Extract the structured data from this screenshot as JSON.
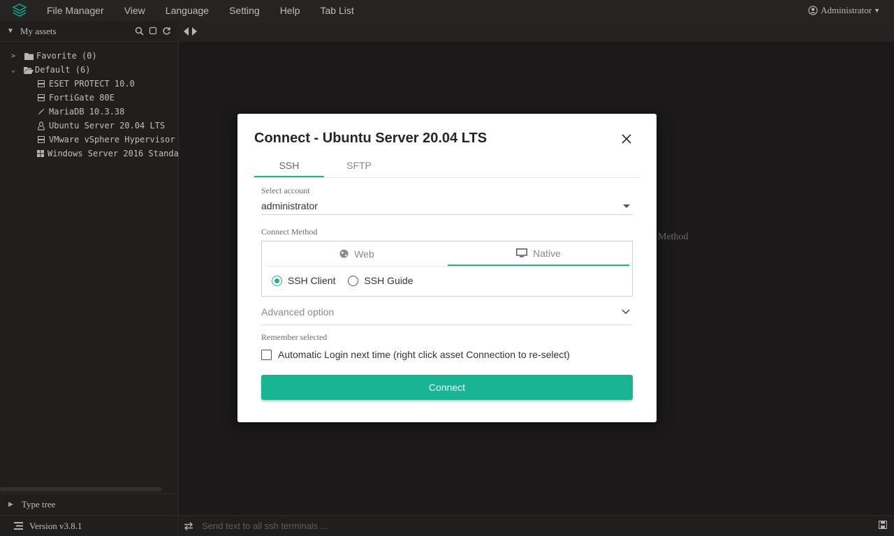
{
  "topbar": {
    "menu": [
      "File Manager",
      "View",
      "Language",
      "Setting",
      "Help",
      "Tab List"
    ],
    "user": "Administrator"
  },
  "sidebar": {
    "title": "My assets",
    "tree": {
      "favorite": "Favorite (0)",
      "default": "Default (6)",
      "assets": [
        {
          "label": "ESET PROTECT 10.0",
          "icon": "server-icon"
        },
        {
          "label": "FortiGate 80E",
          "icon": "server-icon"
        },
        {
          "label": "MariaDB 10.3.38",
          "icon": "database-icon"
        },
        {
          "label": "Ubuntu Server 20.04 LTS",
          "icon": "linux-icon"
        },
        {
          "label": "VMware vSphere Hypervisor",
          "icon": "server-icon"
        },
        {
          "label": "Windows Server 2016 Standa",
          "icon": "windows-icon"
        }
      ]
    },
    "type_tree": "Type tree",
    "version": "Version v3.8.1"
  },
  "main": {
    "background_text": "Method",
    "send_placeholder": "Send text to all ssh terminals ..."
  },
  "modal": {
    "title": "Connect - Ubuntu Server 20.04 LTS",
    "tabs": [
      "SSH",
      "SFTP"
    ],
    "active_tab": "SSH",
    "account_label": "Select account",
    "account_value": "administrator",
    "method_label": "Connect Method",
    "method_tabs": [
      "Web",
      "Native"
    ],
    "active_method": "Native",
    "radio_options": [
      "SSH Client",
      "SSH Guide"
    ],
    "selected_radio": "SSH Client",
    "advanced_label": "Advanced option",
    "remember_label": "Remember selected",
    "auto_login_label": "Automatic Login next time (right click asset Connection to re-select)",
    "connect_label": "Connect"
  },
  "colors": {
    "accent": "#1ab394",
    "background": "#1f1d1d",
    "modal_bg": "#ffffff"
  }
}
